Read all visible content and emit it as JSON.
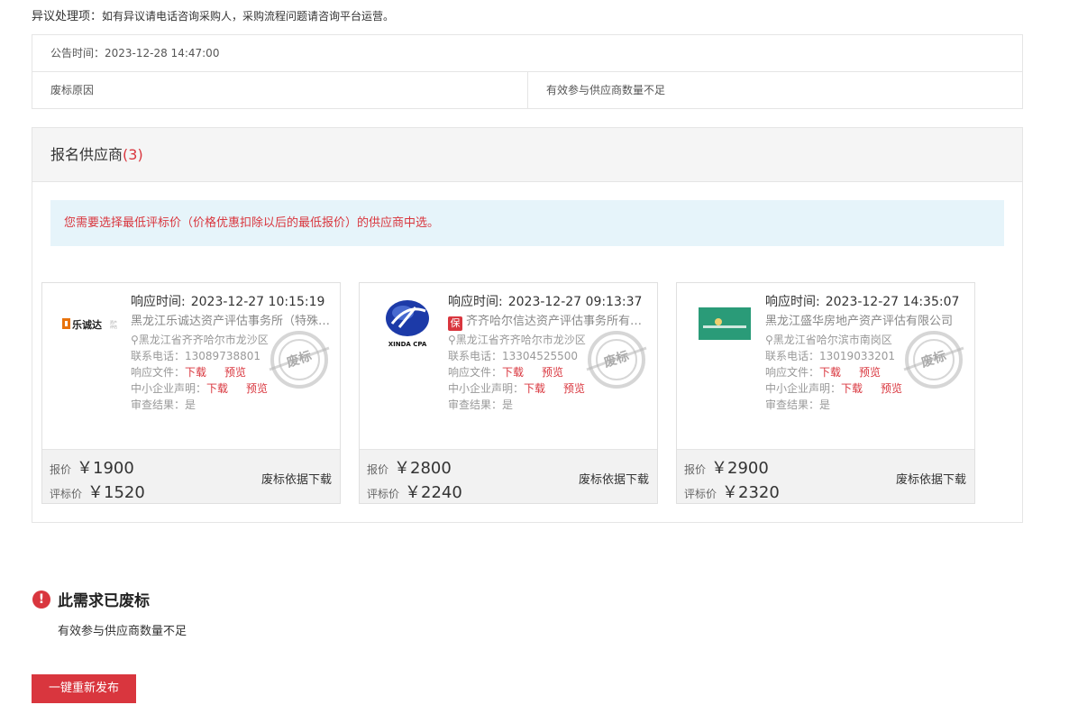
{
  "objection": {
    "label": "异议处理项：",
    "text": "如有异议请电话咨询采购人，采购流程问题请咨询平台运营。"
  },
  "announcement": {
    "time": "公告时间：2023-12-28 14:47:00",
    "reason_label": "废标原因",
    "reason_value": "有效参与供应商数量不足"
  },
  "suppliers": {
    "title": "报名供应商",
    "count": "(3)",
    "notice": "您需要选择最低评标价（价格优惠扣除以后的最低报价）的供应商中选。",
    "labels": {
      "response_time": "响应时间:",
      "phone": "联系电话：",
      "response_file": "响应文件：",
      "sme": "中小企业声明：",
      "review": "审查结果：",
      "download": "下载",
      "preview": "预览",
      "quote": "报价",
      "eval": "评标价",
      "basis_download": "废标依据下载",
      "stamp": "废标"
    },
    "cards": [
      {
        "time": "2023-12-27 10:15:19",
        "name": "黑龙江乐诚达资产评估事务所（特殊普通合伙）",
        "address": "黑龙江省齐齐哈尔市龙沙区",
        "phone": "13089738801",
        "review": "是",
        "quote": "￥1900",
        "eval": "￥1520",
        "logo_text": "乐诚达",
        "badge": ""
      },
      {
        "time": "2023-12-27 09:13:37",
        "name": "齐齐哈尔信达资产评估事务所有限公司",
        "address": "黑龙江省齐齐哈尔市龙沙区",
        "phone": "13304525500",
        "review": "是",
        "quote": "￥2800",
        "eval": "￥2240",
        "logo_text": "XINDA CPA",
        "badge": "保"
      },
      {
        "time": "2023-12-27 14:35:07",
        "name": "黑龙江盛华房地产资产评估有限公司",
        "address": "黑龙江省哈尔滨市南岗区",
        "phone": "13019033201",
        "review": "是",
        "quote": "￥2900",
        "eval": "￥2320",
        "logo_text": "",
        "badge": ""
      }
    ]
  },
  "result": {
    "title": "此需求已废标",
    "reason": "有效参与供应商数量不足"
  },
  "republish_button": "一键重新发布",
  "colors": {
    "accent": "#d9363e",
    "notice_bg": "#e6f4fa"
  }
}
